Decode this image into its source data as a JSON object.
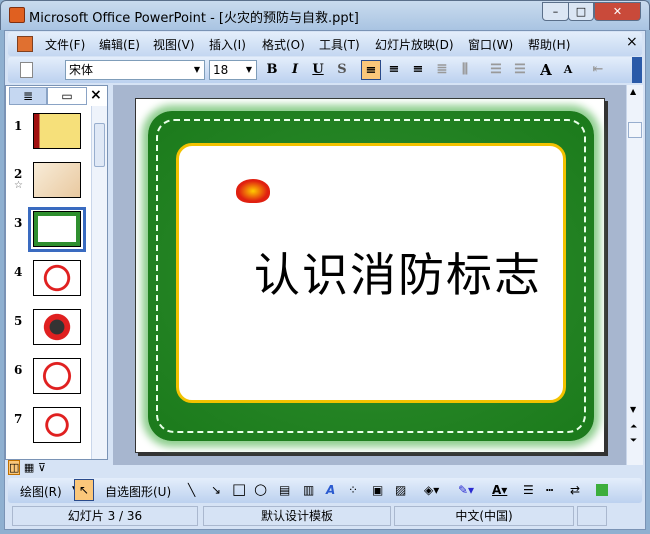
{
  "window": {
    "title": "Microsoft Office PowerPoint - [火灾的预防与自救.ppt]",
    "minimize": "–",
    "maximize": "□",
    "close": "✕"
  },
  "menu": [
    "文件(F)",
    "编辑(E)",
    "视图(V)",
    "插入(I)",
    "格式(O)",
    "工具(T)",
    "幻灯片放映(D)",
    "窗口(W)",
    "帮助(H)"
  ],
  "menu_close": "×",
  "toolbar": {
    "font": "宋体",
    "size": "18",
    "bold": "B",
    "italic": "I",
    "underline": "U",
    "shadow": "S",
    "grow": "A",
    "shrink": "A"
  },
  "pane": {
    "tab_outline": "≣",
    "tab_slides": "▭",
    "close": "×",
    "slides": [
      "1",
      "2",
      "3",
      "4",
      "5",
      "6",
      "7"
    ],
    "current": 3,
    "anim_mark": "☆"
  },
  "slide": {
    "title": "认识消防标志"
  },
  "drawbar": {
    "draw": "绘图(R)",
    "autoshapes": "自选图形(U)"
  },
  "status": {
    "slide": "幻灯片 3 / 36",
    "template": "默认设计模板",
    "language": "中文(中国)"
  }
}
